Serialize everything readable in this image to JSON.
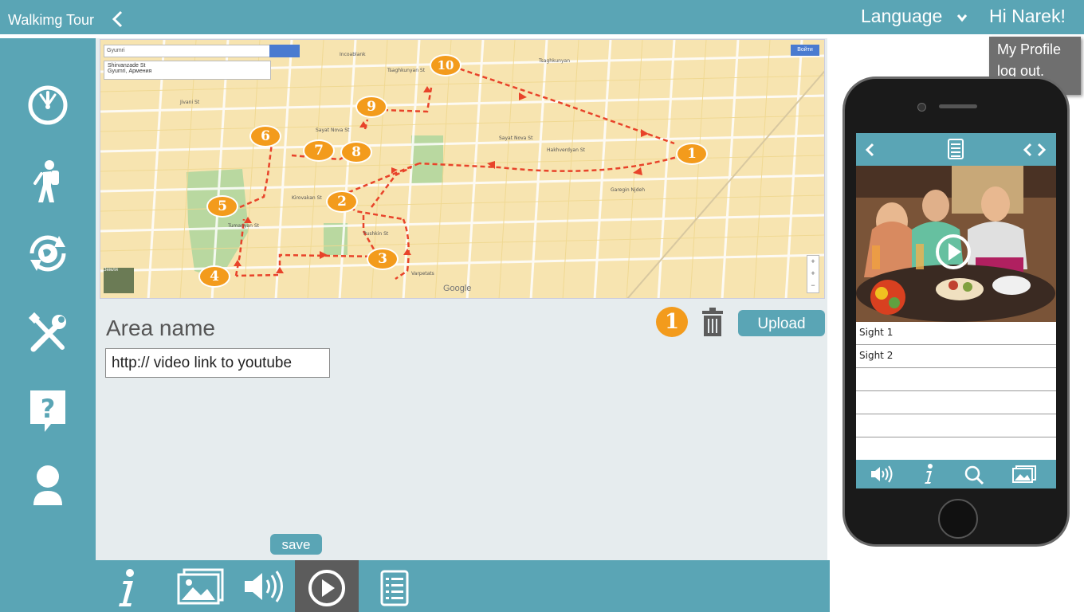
{
  "header": {
    "app_title": "Walkimg Tour",
    "language_label": "Language",
    "greeting": "Hi Narek!"
  },
  "profile_menu": {
    "items": [
      "My Profile",
      "log out."
    ]
  },
  "sidebar": {
    "items": [
      {
        "icon": "dashboard-icon"
      },
      {
        "icon": "hiker-icon"
      },
      {
        "icon": "globe-sync-icon"
      },
      {
        "icon": "tools-icon"
      },
      {
        "icon": "help-icon"
      },
      {
        "icon": "user-icon"
      }
    ]
  },
  "map": {
    "search_text": "Gyumri",
    "info_line1": "Shirvanzade St",
    "info_line2": "Gyumri, Армения",
    "login_label": "Войти",
    "attribution": "Google",
    "thumb_label": "Земля",
    "markers": [
      "1",
      "2",
      "3",
      "4",
      "5",
      "6",
      "7",
      "8",
      "9",
      "10"
    ],
    "route_color": "#e8432a",
    "marker_color": "#f39b1c"
  },
  "form": {
    "area_name_label": "Area name",
    "url_value": "http:// video link to youtube",
    "step_badge": "1",
    "upload_label": "Upload",
    "save_label": "save"
  },
  "bottom_toolbar": {
    "items": [
      {
        "icon": "info-icon"
      },
      {
        "icon": "image-icon"
      },
      {
        "icon": "audio-icon"
      },
      {
        "icon": "play-icon",
        "active": true
      },
      {
        "icon": "list-icon"
      }
    ]
  },
  "phone": {
    "list_items": [
      "Sight 1",
      "Sight 2",
      "",
      "",
      "",
      ""
    ],
    "bottom_icons": [
      "audio-icon",
      "info-icon",
      "search-icon",
      "image-icon"
    ]
  },
  "colors": {
    "accent": "#5aa5b5",
    "active": "#5c5c5c",
    "badge": "#f39b1c"
  }
}
